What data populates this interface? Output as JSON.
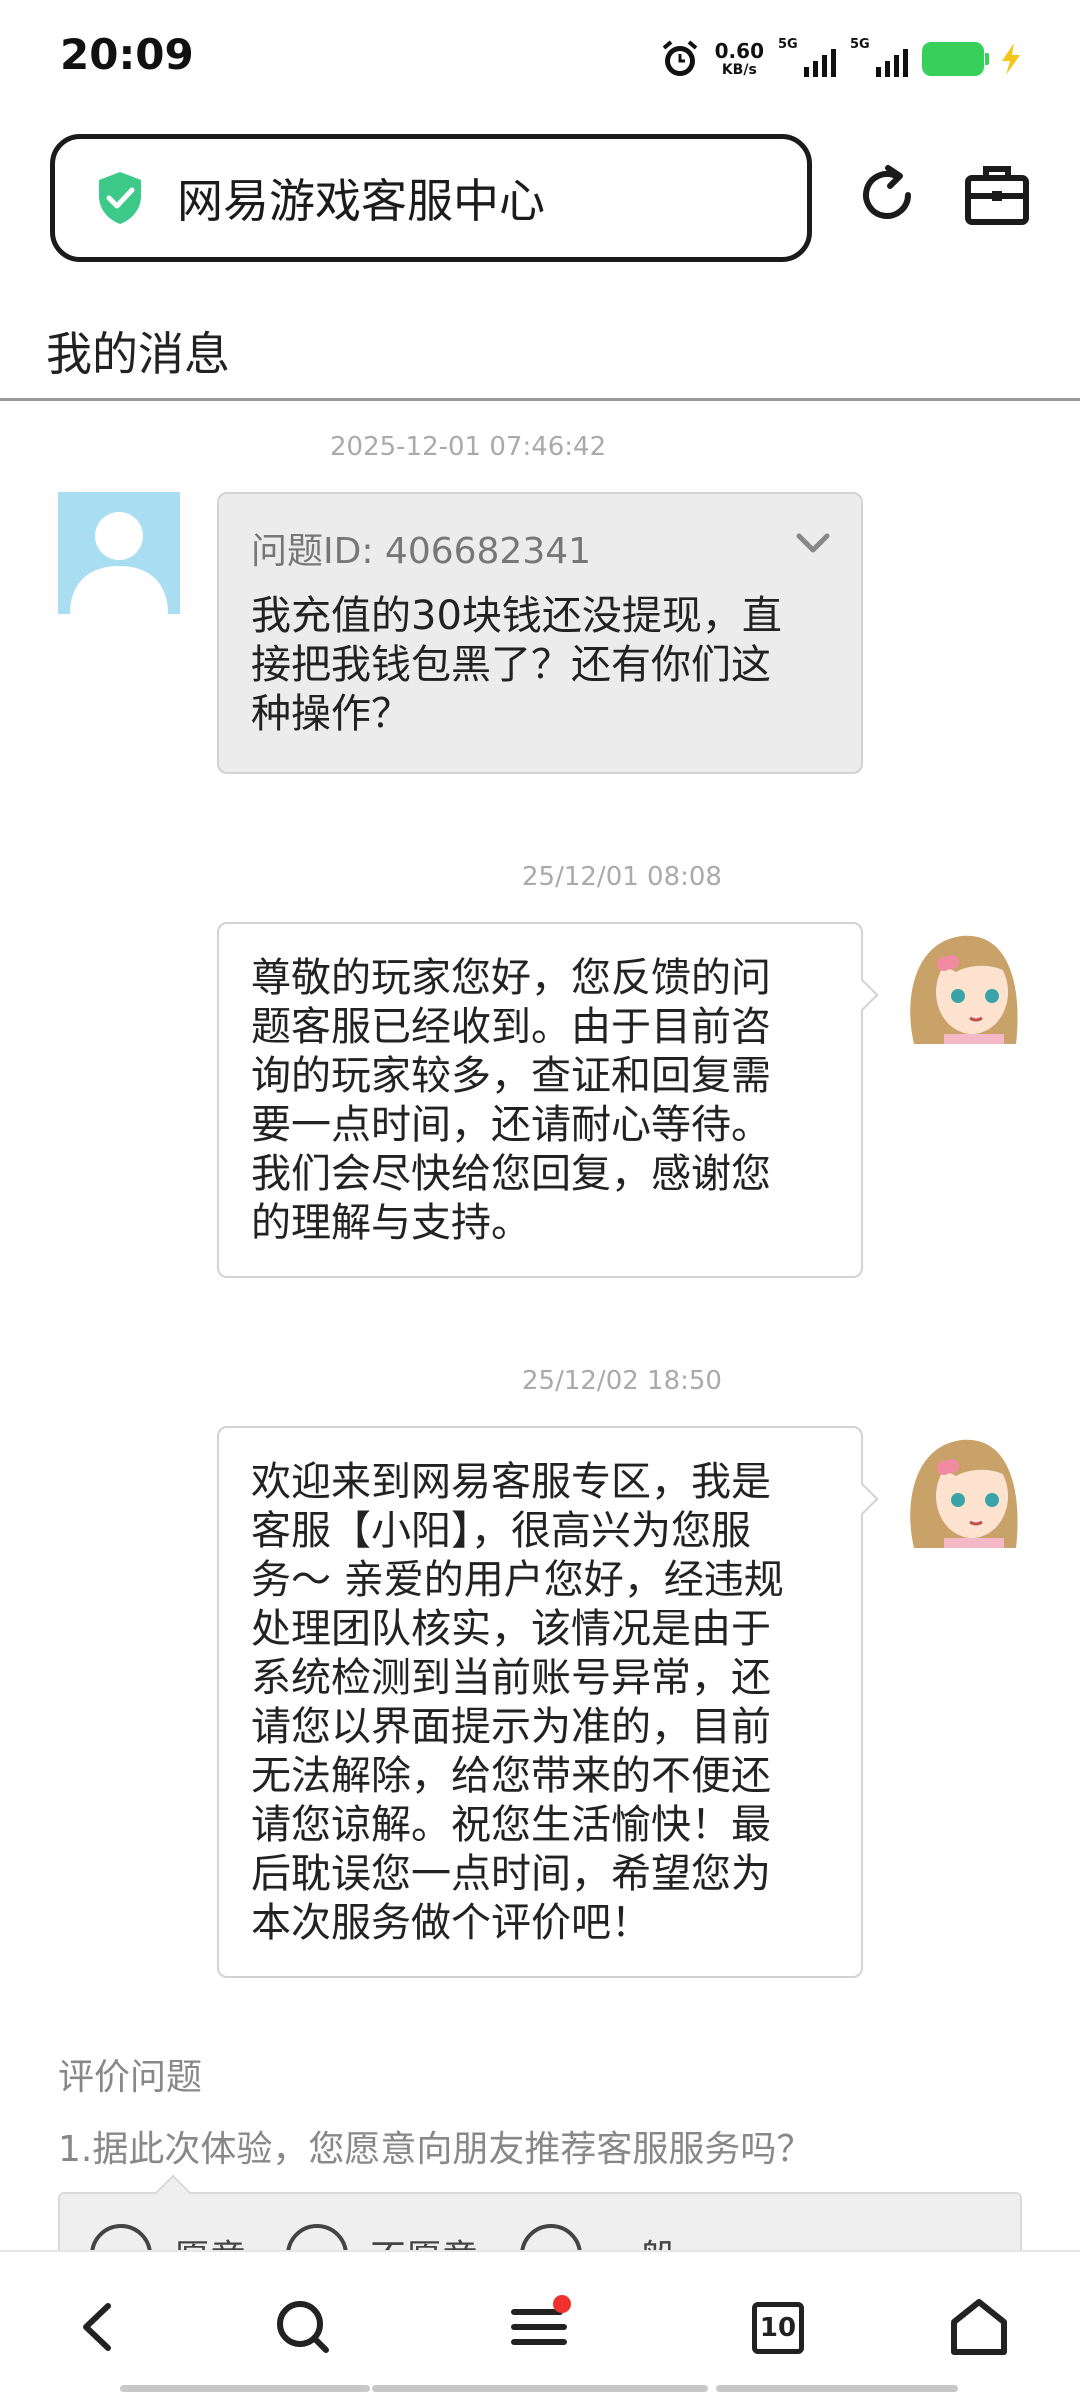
{
  "status_bar": {
    "time": "20:09",
    "net_speed": "0.60",
    "net_speed_unit": "KB/s",
    "sim1": "5G",
    "sim2": "5G",
    "battery_color": "#36d05a"
  },
  "header": {
    "title": "网易游戏客服中心",
    "shield_color": "#3cc98a"
  },
  "page": {
    "title": "我的消息"
  },
  "messages": [
    {
      "timestamp": "2025-12-01 07:46:42",
      "question_id": "问题ID: 406682341",
      "text": [
        "我充值的30块钱还没提现，直",
        "接把我钱包黑了？还有你们这",
        "种操作？"
      ]
    },
    {
      "timestamp": "25/12/01 08:08",
      "text": [
        "尊敬的玩家您好，您反馈的问",
        "题客服已经收到。由于目前咨",
        "询的玩家较多，查证和回复需",
        "要一点时间，还请耐心等待。",
        "我们会尽快给您回复，感谢您",
        "的理解与支持。"
      ]
    },
    {
      "timestamp": "25/12/02 18:50",
      "text": [
        "欢迎来到网易客服专区，我是",
        "客服【小阳】，很高兴为您服",
        "务～ 亲爱的用户您好，经违规",
        "处理团队核实，该情况是由于",
        "系统检测到当前账号异常，还",
        "请您以界面提示为准的，目前",
        "无法解除，给您带来的不便还",
        "请您谅解。祝您生活愉快！最",
        "后耽误您一点时间，希望您为",
        "本次服务做个评价吧！"
      ]
    }
  ],
  "rating": {
    "heading": "评价问题",
    "question": "1.据此次体验，您愿意向朋友推荐客服服务吗？",
    "options": [
      "愿意",
      "不愿意",
      "一般"
    ]
  },
  "bottom_nav": {
    "tab_count": "10",
    "notification_color": "#f0302f"
  }
}
